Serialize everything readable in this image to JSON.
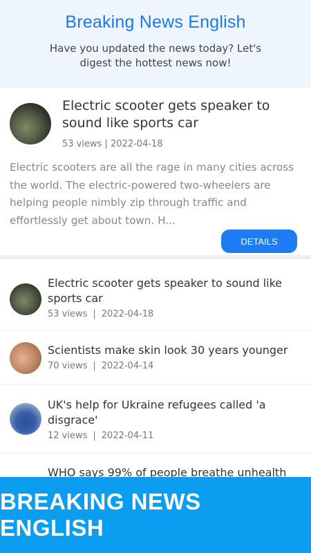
{
  "header": {
    "title": "Breaking News English",
    "subtitle": "Have you updated the news today? Let's digest the hottest news now!"
  },
  "featured": {
    "title": "Electric scooter gets speaker to sound like sports car",
    "meta": "53 views | 2022-04-18",
    "summary": "Electric scooters are all the rage in many cities across the world. The electric-powered two-wheelers are helping people nimbly zip through traffic and effortlessly get about town. H...",
    "button_label": "DETAILS",
    "thumb_icon": "scooter-photo"
  },
  "list": [
    {
      "title": "Electric scooter gets speaker to sound like sports car",
      "views": "53 views",
      "divider": "|",
      "date": "2022-04-18",
      "thumb_icon": "scooter-photo"
    },
    {
      "title": "Scientists make skin look 30 years younger",
      "views": "70 views",
      "divider": "|",
      "date": "2022-04-14",
      "thumb_icon": "skin-photo"
    },
    {
      "title": "UK's help for Ukraine refugees called 'a disgrace'",
      "views": "12 views",
      "divider": "|",
      "date": "2022-04-11",
      "thumb_icon": "protest-photo"
    },
    {
      "title": "WHO says 99% of people breathe unhealth"
    }
  ],
  "banner": {
    "text": "BREAKING NEWS ENGLISH"
  },
  "colors": {
    "accent": "#1a7ae6",
    "button": "#1d7cf2",
    "banner": "#0a9df0",
    "header_bg": "#eef5fd"
  }
}
